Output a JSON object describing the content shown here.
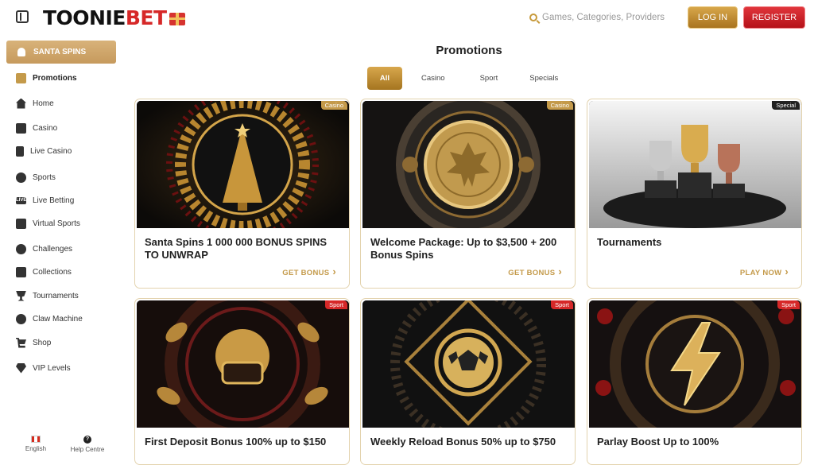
{
  "header": {
    "logo": {
      "part1": "TOONIE",
      "part2": "BET"
    },
    "search_placeholder": "Games, Categories, Providers",
    "login_label": "LOG IN",
    "register_label": "REGISTER"
  },
  "sidebar": {
    "santa_spins_label": "SANTA SPINS",
    "items": [
      {
        "label": "Promotions",
        "icon": "gift-icon"
      },
      {
        "label": "Home",
        "icon": "home-icon"
      },
      {
        "label": "Casino",
        "icon": "slot-machine-icon"
      },
      {
        "label": "Live Casino",
        "icon": "cards-icon"
      },
      {
        "label": "Sports",
        "icon": "ball-icon"
      },
      {
        "label": "Live Betting",
        "icon": "live-icon",
        "icon_text": "LIVE"
      },
      {
        "label": "Virtual Sports",
        "icon": "monitor-icon"
      },
      {
        "label": "Challenges",
        "icon": "target-icon"
      },
      {
        "label": "Collections",
        "icon": "collection-icon"
      },
      {
        "label": "Tournaments",
        "icon": "trophy-icon"
      },
      {
        "label": "Claw Machine",
        "icon": "claw-icon"
      },
      {
        "label": "Shop",
        "icon": "cart-icon"
      },
      {
        "label": "VIP Levels",
        "icon": "diamond-icon"
      }
    ],
    "footer": {
      "language": "English",
      "help": "Help Centre"
    }
  },
  "main": {
    "title": "Promotions",
    "tabs": [
      "All",
      "Casino",
      "Sport",
      "Specials"
    ],
    "cards": [
      {
        "title": "Santa Spins 1 000 000 BONUS SPINS TO UNWRAP",
        "badge": "Casino",
        "link": "GET BONUS",
        "art": "christmas-tree"
      },
      {
        "title": "Welcome Package: Up to $3,500 + 200 Bonus Spins",
        "badge": "Casino",
        "link": "GET BONUS",
        "art": "gold-coin"
      },
      {
        "title": "Tournaments",
        "badge": "Special",
        "link": "PLAY NOW",
        "art": "trophies"
      },
      {
        "title": "First Deposit Bonus 100% up to $150",
        "badge": "Sport",
        "link": "",
        "art": "football-helmet"
      },
      {
        "title": "Weekly Reload Bonus 50% up to $750",
        "badge": "Sport",
        "link": "",
        "art": "soccer-ball"
      },
      {
        "title": "Parlay Boost Up to 100%",
        "badge": "Sport",
        "link": "",
        "art": "lightning-bolt"
      }
    ]
  }
}
